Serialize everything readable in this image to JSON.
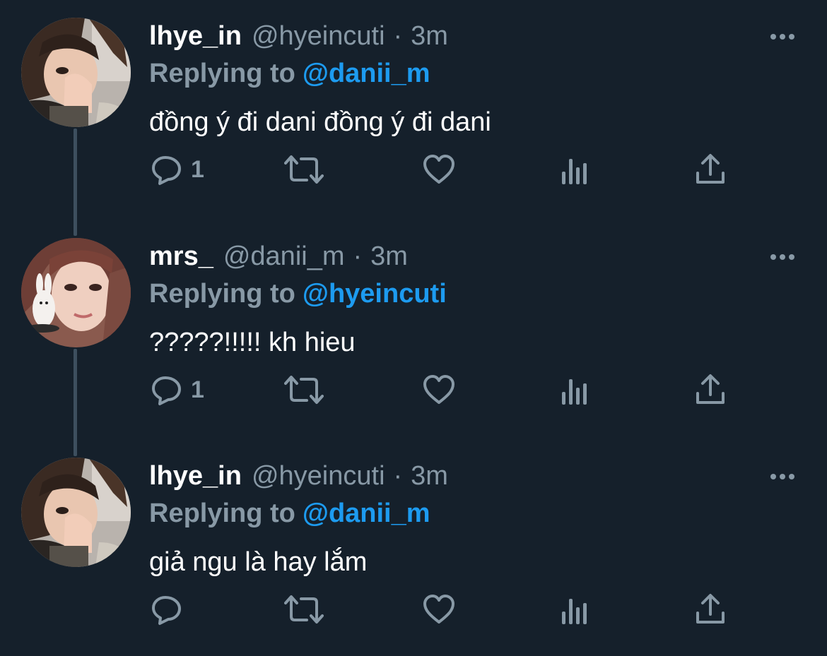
{
  "tweets": [
    {
      "name": "lhye_in",
      "handle": "@hyeincuti",
      "separator": "·",
      "time": "3m",
      "reply_prefix": "Replying to",
      "reply_mention": "@danii_m",
      "text": "đồng ý đi dani đồng ý đi dani",
      "reply_count": "1"
    },
    {
      "name": "mrs_",
      "handle": "@danii_m",
      "separator": "·",
      "time": "3m",
      "reply_prefix": "Replying to",
      "reply_mention": "@hyeincuti",
      "text": "?????!!!!! kh hieu",
      "reply_count": "1"
    },
    {
      "name": "lhye_in",
      "handle": "@hyeincuti",
      "separator": "·",
      "time": "3m",
      "reply_prefix": "Replying to",
      "reply_mention": "@danii_m",
      "text": "giả ngu là hay lắm",
      "reply_count": ""
    }
  ],
  "icons": {
    "reply": "reply-icon",
    "retweet": "retweet-icon",
    "like": "heart-icon",
    "analytics": "analytics-icon",
    "share": "share-icon",
    "more": "more-icon"
  },
  "colors": {
    "background": "#15202b",
    "name": "#ffffff",
    "muted": "#8899a6",
    "mention": "#1d9bf0",
    "thread_line": "#3d4f5e"
  }
}
